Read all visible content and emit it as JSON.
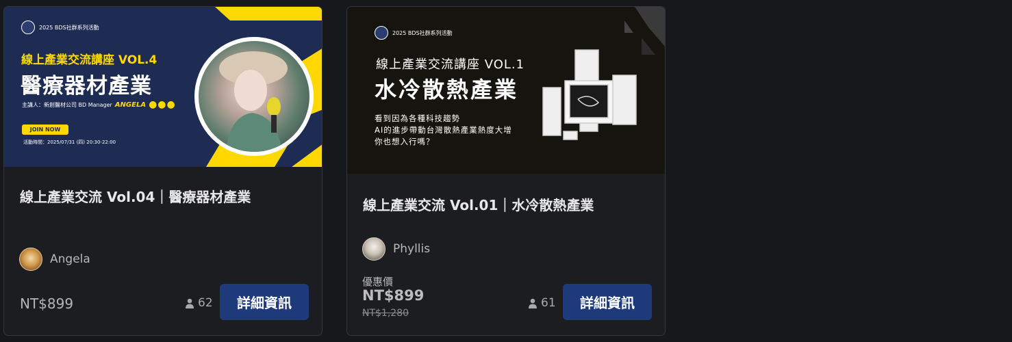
{
  "cards": [
    {
      "banner": {
        "badge": "2025 BDS社群系列活動",
        "series": "線上產業交流講座  VOL.4",
        "title": "醫療器材產業",
        "host_label": "主講人：新創醫材公司 BD Manager",
        "host_name": "ANGELA",
        "host_dots": "●●●",
        "join": "JOIN NOW",
        "time": "活動時間：2025/07/31 (四) 20:30-22:00"
      },
      "title": "線上產業交流 Vol.04｜醫療器材產業",
      "author": "Angela",
      "price": "NT$899",
      "attendees": "62",
      "button": "詳細資訊"
    },
    {
      "banner": {
        "badge": "2025 BDS社群系列活動",
        "series": "線上產業交流講座 VOL.1",
        "title": "水冷散熱產業",
        "description": "看到因為各種科技趨勢\nAI的進步帶動台灣散熱產業熱度大增\n你也想入行嗎？"
      },
      "title": "線上產業交流 Vol.01｜水冷散熱產業",
      "author": "Phyllis",
      "sale_label": "優惠價",
      "sale_price": "NT$899",
      "original_price": "NT$1,280",
      "attendees": "61",
      "button": "詳細資訊"
    }
  ],
  "colors": {
    "background": "#17181b",
    "card": "#1c1d21",
    "button": "#1e3a7a",
    "accent_yellow": "#ffd800"
  },
  "icons": {
    "attendee": "person-icon"
  }
}
